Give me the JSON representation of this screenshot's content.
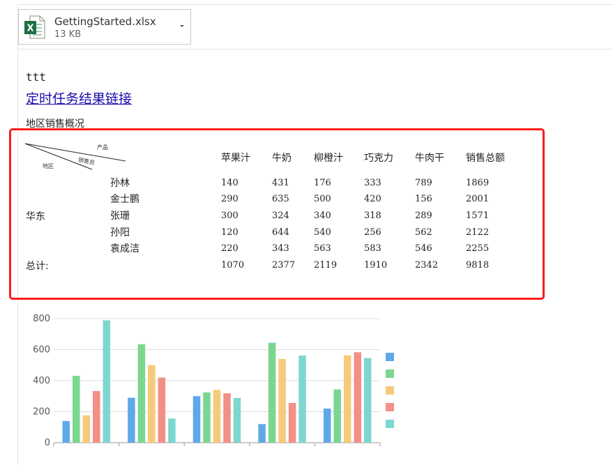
{
  "attachment": {
    "file_name": "GettingStarted.xlsx",
    "file_size": "13 KB",
    "icon": "excel-icon",
    "icon_color": "#1d7044"
  },
  "body": {
    "mono_text": "ttt",
    "link_text": "定时任务结果链接",
    "section_title": "地区销售概况"
  },
  "table": {
    "corner": {
      "product": "产品",
      "salesperson": "销售员",
      "region": "地区"
    },
    "headers": [
      "苹果汁",
      "牛奶",
      "柳橙汁",
      "巧克力",
      "牛肉干",
      "销售总额"
    ],
    "region": "华东",
    "rows": [
      {
        "name": "孙林",
        "values": [
          "140",
          "431",
          "176",
          "333",
          "789",
          "1869"
        ]
      },
      {
        "name": "金士鹏",
        "values": [
          "290",
          "635",
          "500",
          "420",
          "156",
          "2001"
        ]
      },
      {
        "name": "张珊",
        "values": [
          "300",
          "324",
          "340",
          "318",
          "289",
          "1571"
        ]
      },
      {
        "name": "孙阳",
        "values": [
          "120",
          "644",
          "540",
          "256",
          "562",
          "2122"
        ]
      },
      {
        "name": "袁成洁",
        "values": [
          "220",
          "343",
          "563",
          "583",
          "546",
          "2255"
        ]
      }
    ],
    "total_label": "总计:",
    "totals": [
      "1070",
      "2377",
      "2119",
      "1910",
      "2342",
      "9818"
    ]
  },
  "highlight_color": "#ff1a1a",
  "chart_data": {
    "type": "bar",
    "ylim": [
      0,
      800
    ],
    "yticks": [
      "0",
      "200",
      "400",
      "600",
      "800"
    ],
    "categories": [
      "",
      "",
      "",
      "",
      ""
    ],
    "series": [
      {
        "values": [
          140,
          290,
          300,
          120,
          220
        ],
        "color": "#5fa8e8"
      },
      {
        "values": [
          431,
          635,
          324,
          644,
          343
        ],
        "color": "#7bd68f"
      },
      {
        "values": [
          176,
          500,
          340,
          540,
          563
        ],
        "color": "#f7c97a"
      },
      {
        "values": [
          333,
          420,
          318,
          256,
          583
        ],
        "color": "#f28f87"
      },
      {
        "values": [
          789,
          156,
          289,
          562,
          546
        ],
        "color": "#7ed6d0"
      }
    ],
    "grid": true,
    "legend": "right"
  }
}
